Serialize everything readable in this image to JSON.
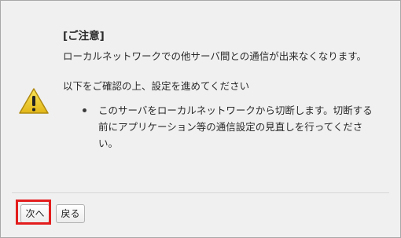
{
  "dialog": {
    "title": "[ご注意]",
    "message": "ローカルネットワークでの他サーバ間との通信が出来なくなります。",
    "instruction": "以下をご確認の上、設定を進めてください",
    "bullets": [
      "このサーバをローカルネットワークから切断します。切断する前にアプリケーション等の通信設定の見直しを行ってください。"
    ],
    "icon": "warning-icon",
    "highlight_color": "#e31d1d"
  },
  "buttons": {
    "next_label": "次へ",
    "back_label": "戻る"
  }
}
